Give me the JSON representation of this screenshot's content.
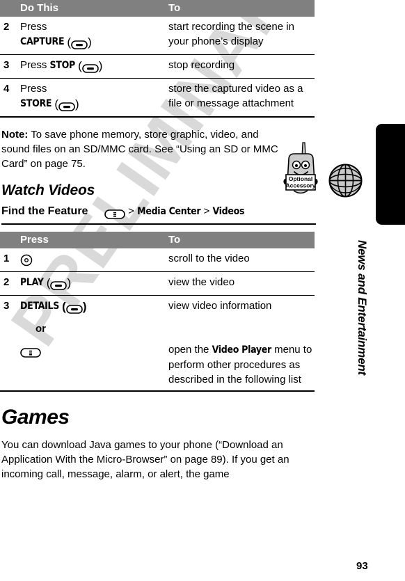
{
  "watermark": {
    "text": "PRELIMINARY"
  },
  "page_number": "93",
  "sidebar": {
    "title": "News and Entertainment",
    "icon": "globe-icon"
  },
  "record_table": {
    "headers": {
      "action": "Do This",
      "result": "To"
    },
    "rows": [
      {
        "num": "2",
        "action_pre": "Press",
        "action_key_label": "CAPTURE",
        "action_key_icon": "softkey-icon",
        "result": "start recording the scene in your phone’s display"
      },
      {
        "num": "3",
        "action_pre": "Press",
        "action_key_label": "STOP",
        "action_key_icon": "softkey-icon",
        "result": "stop recording"
      },
      {
        "num": "4",
        "action_pre": "Press",
        "action_key_label": "STORE",
        "action_key_icon": "softkey-icon",
        "result": "store the captured video as a file or message attachment"
      }
    ]
  },
  "note": {
    "label": "Note:",
    "text": " To save phone memory, store graphic, video, and sound files on an SD/MMC card. See “Using an SD or MMC Card” on page 75.",
    "icon": "optional-accessory-icon",
    "icon_line1": "Optional",
    "icon_line2": "Accessory"
  },
  "watch_videos": {
    "heading": "Watch Videos",
    "find_feature": {
      "label": "Find the Feature",
      "key_icon": "menu-key-icon",
      "path_sep_1": ">",
      "path_1": "Media Center",
      "path_sep_2": ">",
      "path_2": "Videos"
    },
    "table": {
      "headers": {
        "action": "Press",
        "result": "To"
      },
      "rows": [
        {
          "num": "1",
          "action_key_icon": "navigation-key-icon",
          "action_key_label": "",
          "result": "scroll to the video"
        },
        {
          "num": "2",
          "action_key_label": "PLAY",
          "action_key_icon": "softkey-icon",
          "result": "view the video"
        },
        {
          "num": "3",
          "action_key_label": "DETAILS",
          "action_key_icon": "softkey-icon",
          "result": "view video information"
        }
      ],
      "or_label": "or",
      "or_row": {
        "action_key_icon": "menu-key-icon",
        "result_pre": "open the ",
        "result_menu": "Video Player",
        "result_post": " menu to perform other procedures as described in the following list"
      }
    }
  },
  "games": {
    "heading": "Games",
    "body": "You can download Java games to your phone (“Download an Application With the Micro-Browser” on page 89). If you get an incoming call, message, alarm, or alert, the game"
  },
  "colors": {
    "header_bg": "#808080",
    "header_text": "#ffffff",
    "rule": "#000000",
    "watermark": "#d9d9d9",
    "sidebar_tab": "#000000"
  }
}
